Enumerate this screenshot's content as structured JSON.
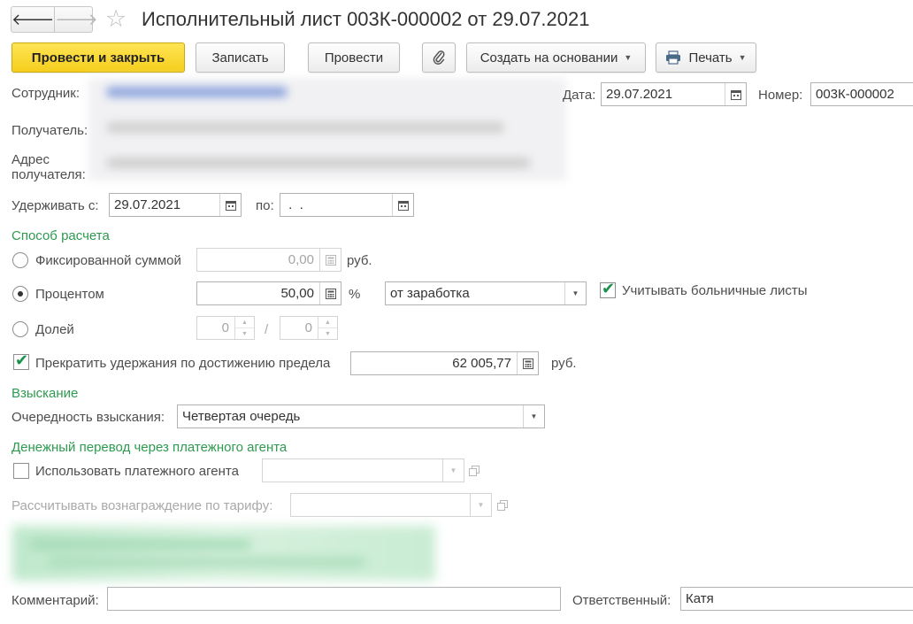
{
  "window": {
    "title": "Исполнительный лист 003К-000002 от 29.07.2021"
  },
  "toolbar": {
    "post_close": "Провести и закрыть",
    "save": "Записать",
    "post": "Провести",
    "create_based": "Создать на основании",
    "print": "Печать"
  },
  "header": {
    "employee_label": "Сотрудник:",
    "date_label": "Дата:",
    "date_value": "29.07.2021",
    "number_label": "Номер:",
    "number_value": "003К-000002",
    "recipient_label": "Получатель:",
    "address_label_1": "Адрес",
    "address_label_2": "получателя:"
  },
  "period": {
    "from_label": "Удерживать с:",
    "from_value": "29.07.2021",
    "to_label": "по:",
    "to_value": " .  ."
  },
  "calc": {
    "section_title": "Способ расчета",
    "fixed_label": "Фиксированной суммой",
    "fixed_value": "0,00",
    "fixed_unit": "руб.",
    "percent_label": "Процентом",
    "percent_value": "50,00",
    "percent_unit": "%",
    "percent_base": "от заработка",
    "sick_label": "Учитывать больничные листы",
    "share_label": "Долей",
    "share_num": "0",
    "share_slash": "/",
    "share_den": "0",
    "limit_label": "Прекратить удержания по достижению предела",
    "limit_value": "62 005,77",
    "limit_unit": "руб.",
    "selected_method": "percent"
  },
  "collection": {
    "section_title": "Взыскание",
    "order_label": "Очередность взыскания:",
    "order_value": "Четвертая очередь"
  },
  "transfer": {
    "section_title": "Денежный перевод через платежного агента",
    "use_agent_label": "Использовать платежного агента",
    "use_agent_value": "",
    "tariff_label": "Рассчитывать вознаграждение по тарифу:",
    "tariff_value": ""
  },
  "footer": {
    "comment_label": "Комментарий:",
    "comment_value": "",
    "responsible_label": "Ответственный:",
    "responsible_value": "Катя"
  },
  "colors": {
    "accent_green": "#2e9a4f",
    "primary_button": "#f5cf1d",
    "check_mark": "#18914a"
  }
}
